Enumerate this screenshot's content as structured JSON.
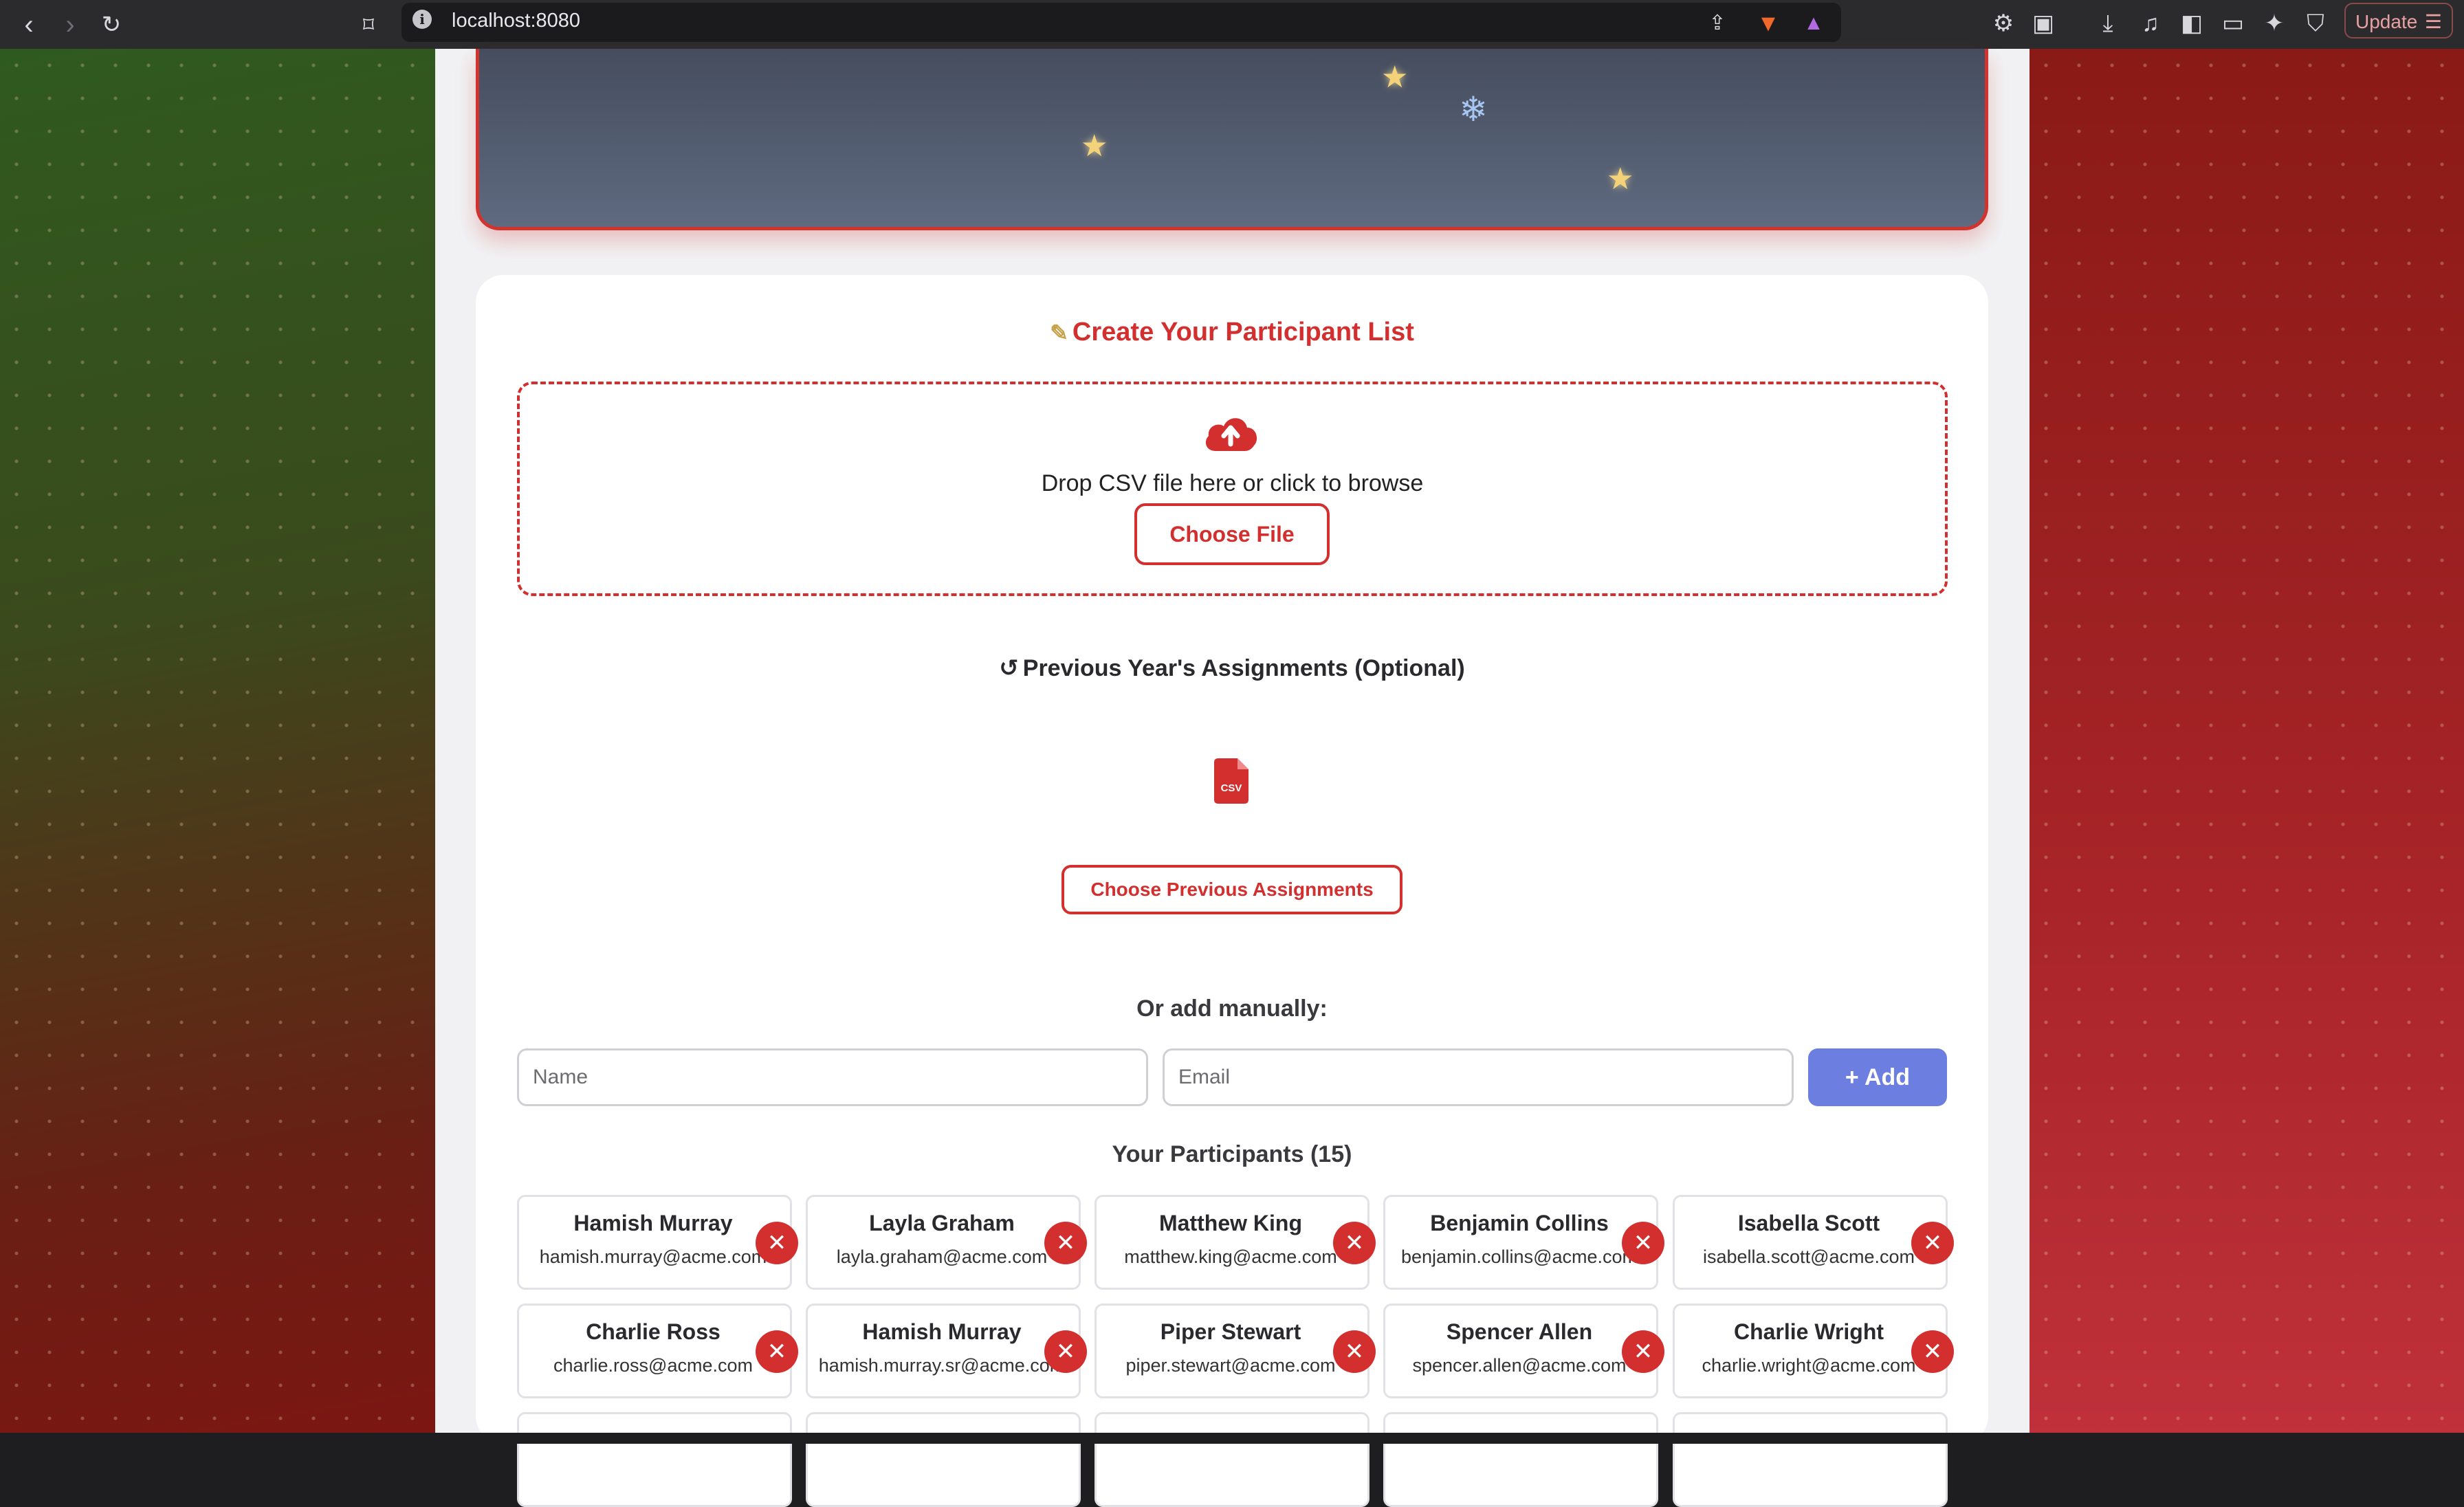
{
  "browser": {
    "url": "localhost:8080",
    "update_label": "Update"
  },
  "hero": {
    "decorations": [
      "star-icon",
      "star-icon",
      "snowflake-icon",
      "star-icon"
    ]
  },
  "upload": {
    "title": "Create Your Participant List",
    "drop_text": "Drop CSV file here or click to browse",
    "choose_file_label": "Choose File"
  },
  "previous": {
    "title": "Previous Year's Assignments (Optional)",
    "choose_label": "Choose Previous Assignments",
    "file_icon_text": "CSV"
  },
  "manual": {
    "title": "Or add manually:",
    "name_placeholder": "Name",
    "email_placeholder": "Email",
    "add_label": "+ Add"
  },
  "participants": {
    "title": "Your Participants (15)",
    "items": [
      {
        "name": "Hamish Murray",
        "email": "hamish.murray@acme.com"
      },
      {
        "name": "Layla Graham",
        "email": "layla.graham@acme.com"
      },
      {
        "name": "Matthew King",
        "email": "matthew.king@acme.com"
      },
      {
        "name": "Benjamin Collins",
        "email": "benjamin.collins@acme.com"
      },
      {
        "name": "Isabella Scott",
        "email": "isabella.scott@acme.com"
      },
      {
        "name": "Charlie Ross",
        "email": "charlie.ross@acme.com"
      },
      {
        "name": "Hamish Murray",
        "email": "hamish.murray.sr@acme.com"
      },
      {
        "name": "Piper Stewart",
        "email": "piper.stewart@acme.com"
      },
      {
        "name": "Spencer Allen",
        "email": "spencer.allen@acme.com"
      },
      {
        "name": "Charlie Wright",
        "email": "charlie.wright@acme.com"
      }
    ]
  },
  "colors": {
    "accent": "#d32f2f",
    "add_button": "#6c7fe0",
    "hero": "#5f6a80"
  }
}
